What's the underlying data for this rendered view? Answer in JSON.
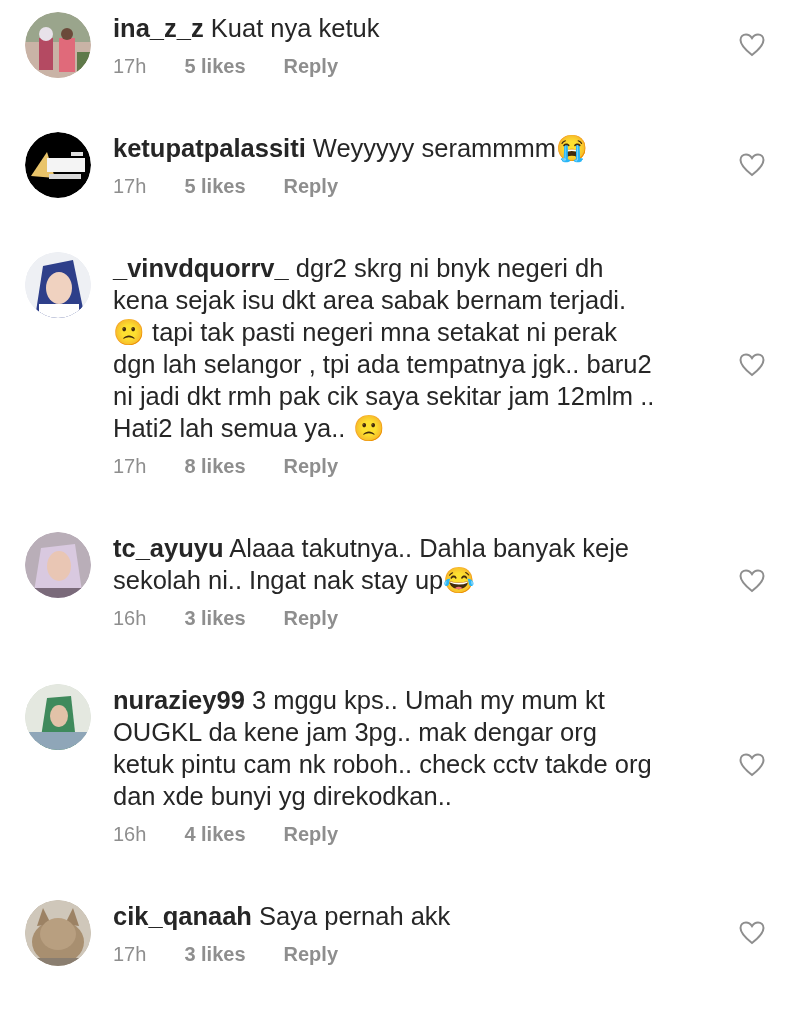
{
  "comments": [
    {
      "username": "ina_z_z",
      "text": "Kuat nya ketuk",
      "time": "17h",
      "likes": "5 likes",
      "reply": "Reply",
      "liked": false
    },
    {
      "username": "ketupatpalassiti",
      "text": "Weyyyyy serammmm😭",
      "time": "17h",
      "likes": "5 likes",
      "reply": "Reply",
      "liked": false
    },
    {
      "username": "_vinvdquorrv_",
      "text": "dgr2 skrg ni bnyk negeri dh kena sejak isu dkt area sabak bernam terjadi. 🙁 tapi tak pasti negeri mna setakat ni perak dgn lah selangor , tpi ada tempatnya jgk.. baru2 ni jadi dkt rmh pak cik saya sekitar jam 12mlm .. Hati2 lah semua ya.. 🙁",
      "time": "17h",
      "likes": "8 likes",
      "reply": "Reply",
      "liked": false
    },
    {
      "username": "tc_ayuyu",
      "text": "Alaaa takutnya.. Dahla banyak keje sekolah ni.. Ingat nak stay up😂",
      "time": "16h",
      "likes": "3 likes",
      "reply": "Reply",
      "liked": false
    },
    {
      "username": "nuraziey99",
      "text": "3 mggu kps.. Umah my mum kt OUGKL da kene jam 3pg.. mak dengar org ketuk pintu cam nk roboh.. check cctv takde org dan xde bunyi yg direkodkan..",
      "time": "16h",
      "likes": "4 likes",
      "reply": "Reply",
      "liked": false
    },
    {
      "username": "cik_qanaah",
      "text": "Saya pernah akk",
      "time": "17h",
      "likes": "3 likes",
      "reply": "Reply",
      "liked": false
    }
  ]
}
